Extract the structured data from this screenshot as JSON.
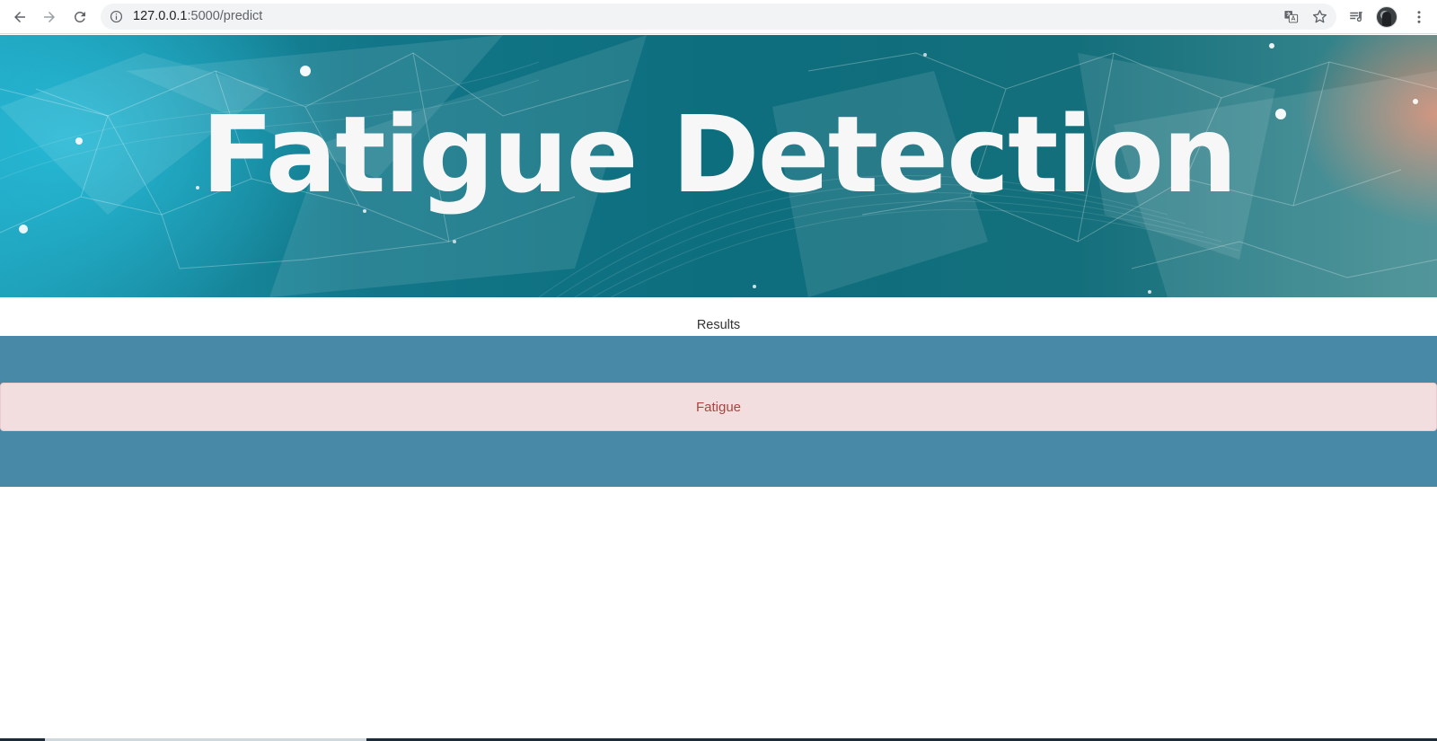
{
  "browser": {
    "url_host": "127.0.0.1",
    "url_rest": ":5000/predict",
    "icons": {
      "back": "back-arrow-icon",
      "forward": "forward-arrow-icon",
      "reload": "reload-icon",
      "info": "info-icon",
      "translate": "translate-icon",
      "bookmark": "star-icon",
      "media": "media-queue-icon",
      "menu": "kebab-menu-icon"
    }
  },
  "banner": {
    "title": "Fatigue Detection"
  },
  "results": {
    "heading": "Results",
    "prediction": "Fatigue"
  },
  "colors": {
    "band": "#4889a7",
    "alert_bg": "#f2dede",
    "alert_text": "#a94442",
    "title_text": "#f7f7f7"
  }
}
